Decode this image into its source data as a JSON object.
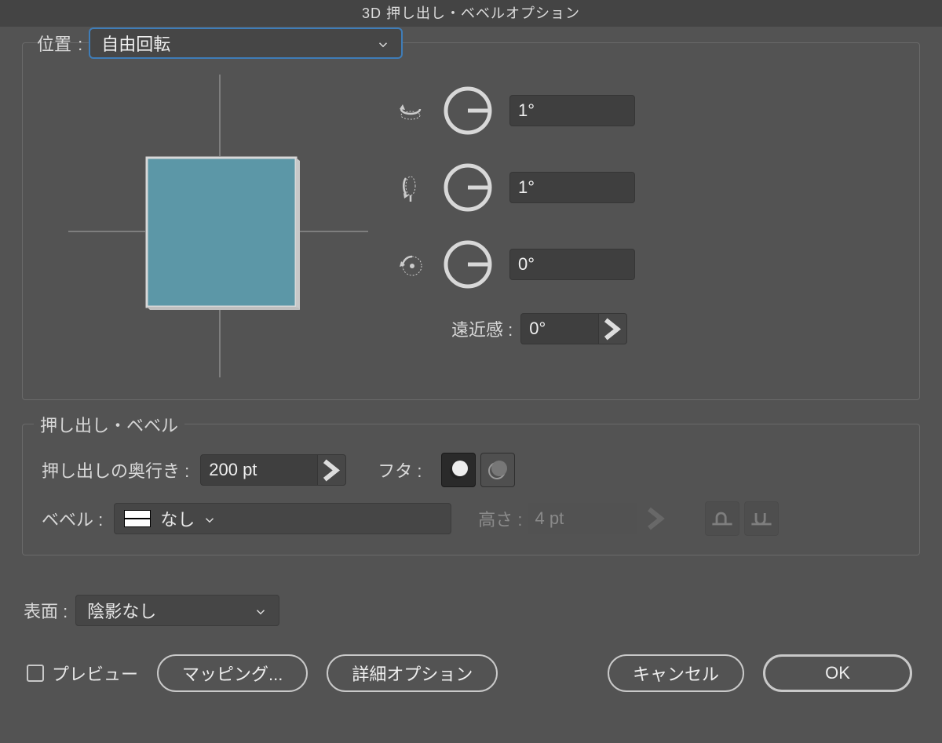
{
  "dialog": {
    "title": "3D 押し出し・ベベルオプション"
  },
  "position": {
    "label": "位置",
    "value": "自由回転",
    "rotation": {
      "x": "1°",
      "y": "1°",
      "z": "0°"
    },
    "perspective": {
      "label": "遠近感",
      "value": "0°"
    }
  },
  "extrude_bevel": {
    "title": "押し出し・ベベル",
    "depth": {
      "label": "押し出しの奥行き",
      "value": "200 pt"
    },
    "cap": {
      "label": "フタ",
      "on_selected": true
    },
    "bevel": {
      "label": "ベベル",
      "value": "なし"
    },
    "height": {
      "label": "高さ",
      "value": "4 pt"
    }
  },
  "surface": {
    "label": "表面",
    "value": "陰影なし"
  },
  "footer": {
    "preview": "プレビュー",
    "map_art": "マッピング...",
    "more_options": "詳細オプション",
    "cancel": "キャンセル",
    "ok": "OK"
  },
  "icons": {
    "axis_x": "rotate-x-icon",
    "axis_y": "rotate-y-icon",
    "axis_z": "rotate-z-icon",
    "cap_on": "cap-on-icon",
    "cap_off": "cap-off-icon",
    "bevel_in": "bevel-in-icon",
    "bevel_out": "bevel-out-icon"
  },
  "colors": {
    "preview_face": "#5c97a7",
    "preview_edge": "#d9d9d9",
    "axis_line": "#7e7e7e"
  }
}
